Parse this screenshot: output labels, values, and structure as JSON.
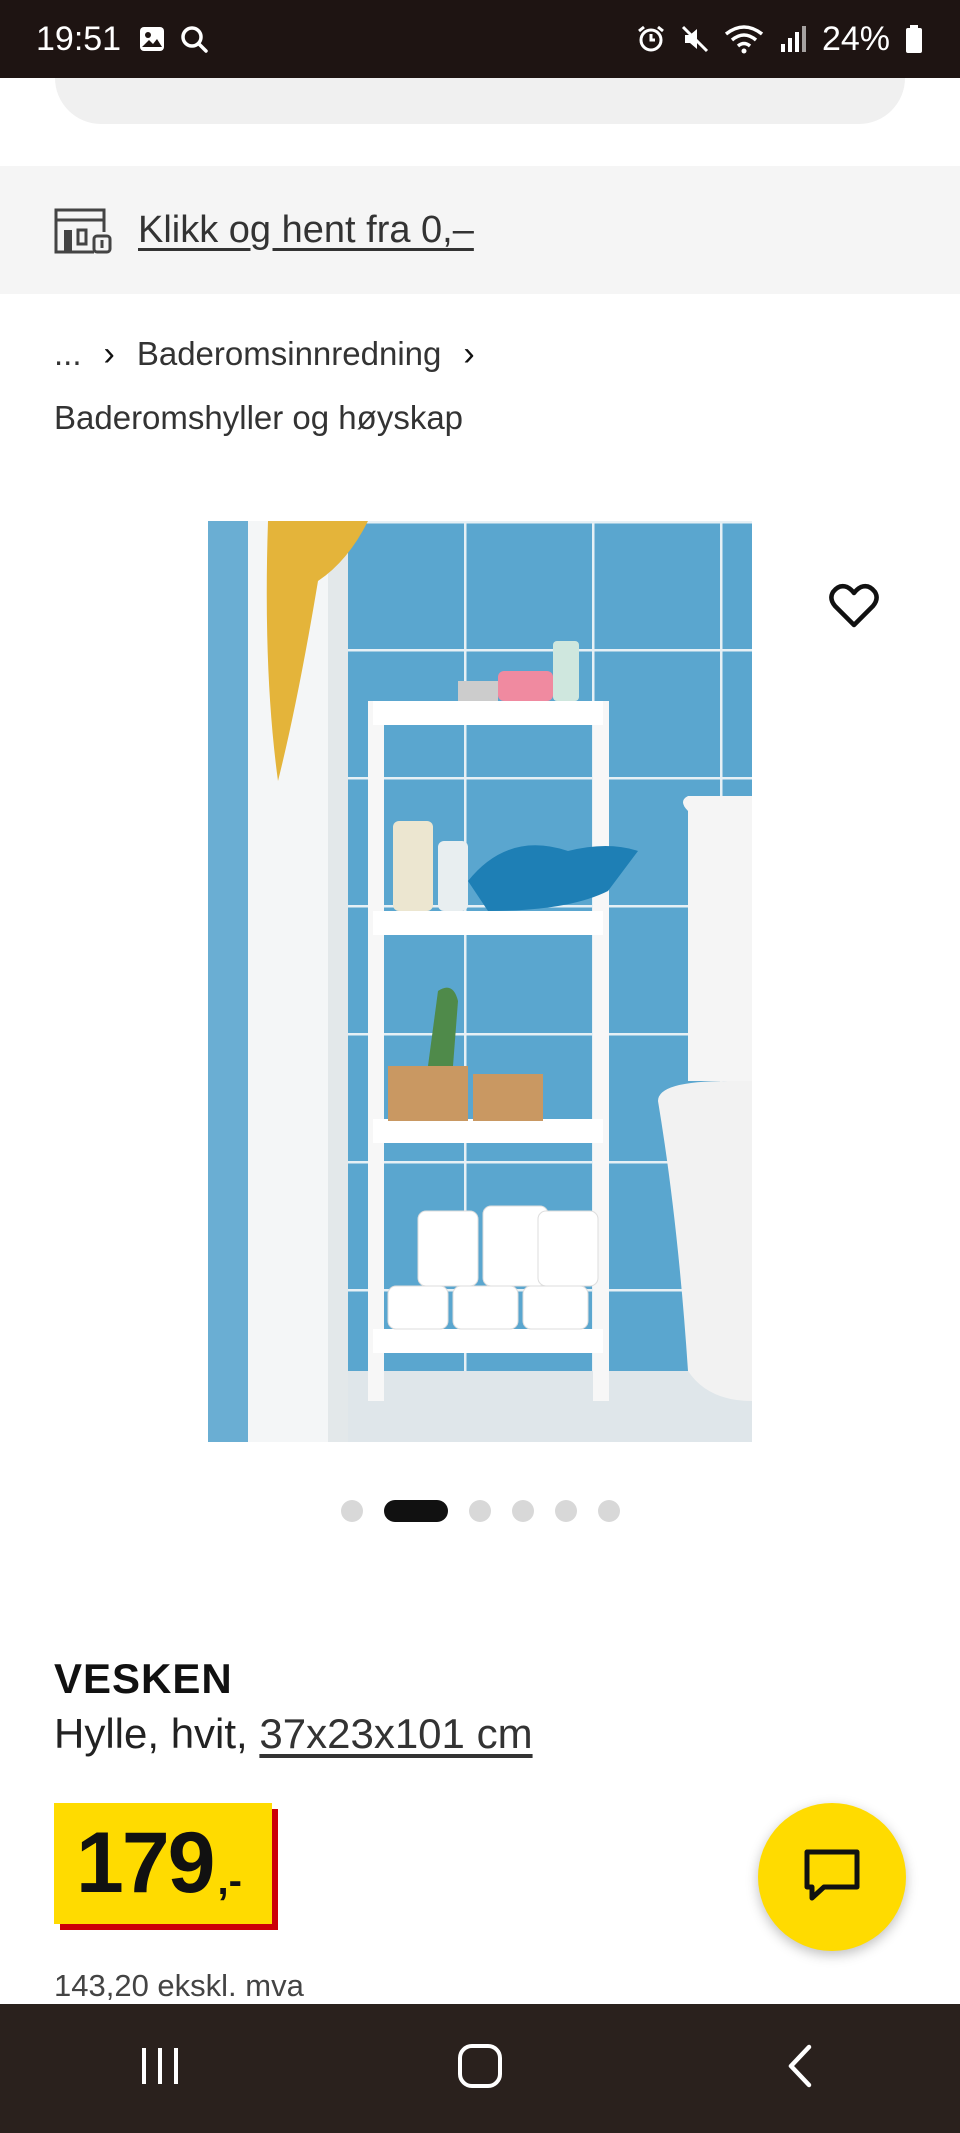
{
  "status_bar": {
    "time": "19:51",
    "battery": "24%",
    "icons": [
      "gallery-icon",
      "search-icon",
      "alarm-icon",
      "mute-icon",
      "wifi-icon",
      "signal-icon",
      "battery-icon"
    ]
  },
  "click_collect": {
    "label": "Klikk og hent fra 0,–",
    "icon": "store-icon"
  },
  "breadcrumb": {
    "ellipsis": "...",
    "level1": "Baderomsinnredning",
    "level2": "Baderomshyller og høyskap"
  },
  "gallery": {
    "total_images": 6,
    "active_index": 1
  },
  "product": {
    "name": "VESKEN",
    "description_prefix": "Hylle, hvit, ",
    "dimensions": "37x23x101 cm",
    "price": "179",
    "price_suffix": ",-",
    "price_excl_vat": "143,20 ekskl. mva"
  },
  "colors": {
    "brand_yellow": "#ffdb00",
    "price_shadow_red": "#cc0008",
    "status_bar": "#1e1412",
    "nav_bar": "#2a211d"
  }
}
